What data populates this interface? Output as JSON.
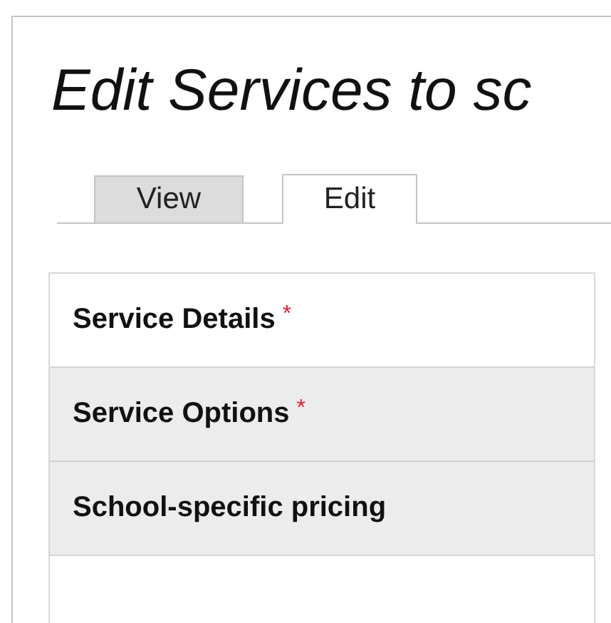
{
  "page": {
    "title": "Edit Services to sc"
  },
  "tabs": [
    {
      "label": "View",
      "selected": false
    },
    {
      "label": "Edit",
      "selected": true
    }
  ],
  "sections": [
    {
      "label": "Service Details",
      "required_mark": "*",
      "expanded": true
    },
    {
      "label": "Service Options",
      "required_mark": "*",
      "expanded": false
    },
    {
      "label": "School-specific pricing",
      "expanded": false
    }
  ]
}
